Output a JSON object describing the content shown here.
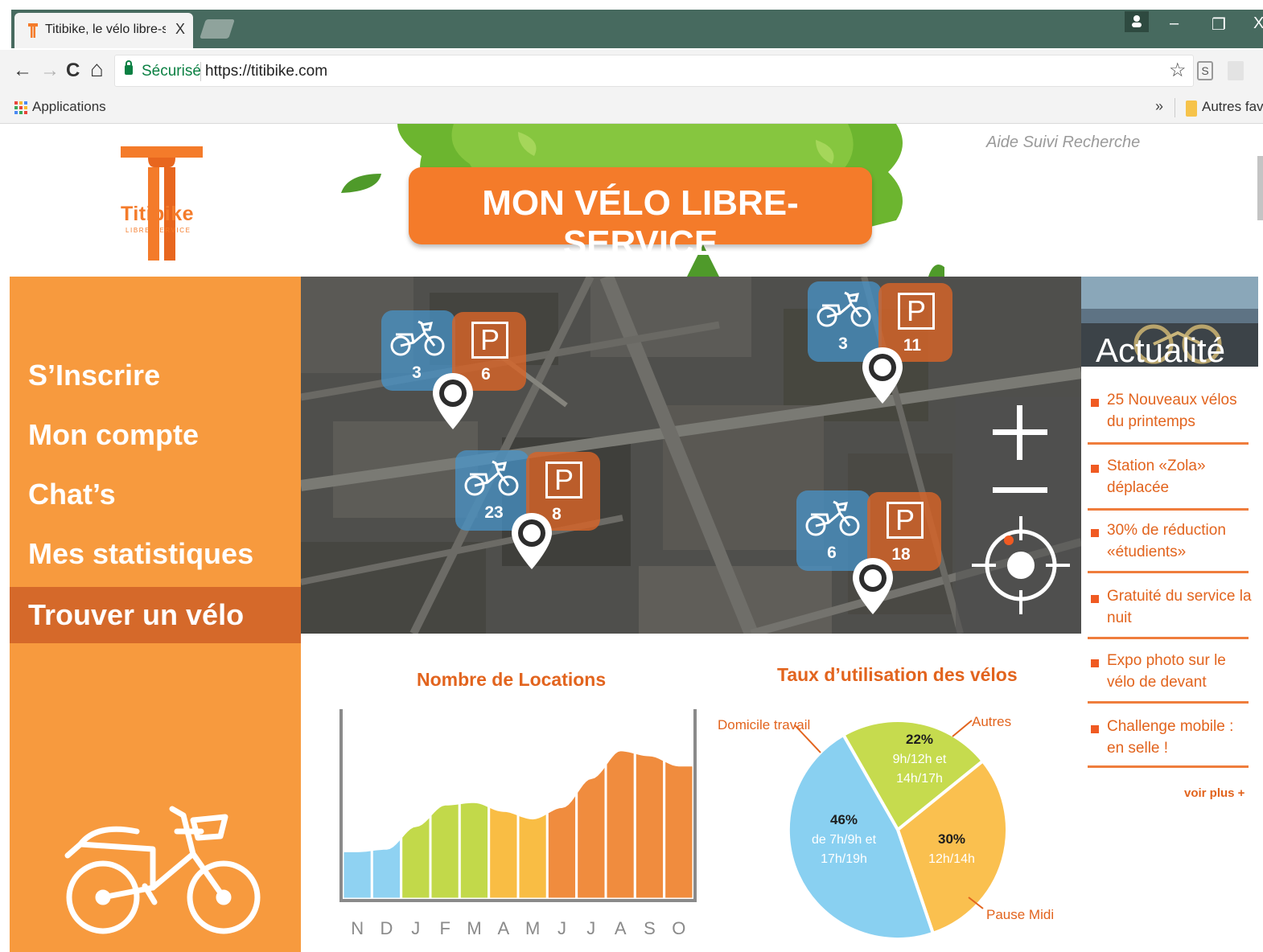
{
  "browser": {
    "tab_title": "Titibike, le vélo libre-serv",
    "tab_close": "X",
    "secure_label": "Sécurisé",
    "url": "https://titibike.com",
    "bookmark_apps": "Applications",
    "bookmark_more": "»",
    "bookmark_other": "Autres favor",
    "nav": {
      "back": "←",
      "forward": "→",
      "reload": "C",
      "home": "⌂",
      "star": "☆",
      "minimize": "–",
      "maximize": "❐",
      "close": "X"
    }
  },
  "header": {
    "logo_text": "Titibike",
    "logo_sub": "LIBRE-SERVICE",
    "banner": "MON VÉLO LIBRE-SERVICE",
    "top_links": "Aide Suivi Recherche"
  },
  "sidebar": {
    "items": [
      {
        "label": "S’Inscrire",
        "active": false
      },
      {
        "label": "Mon compte",
        "active": false
      },
      {
        "label": "Chat’s",
        "active": false
      },
      {
        "label": "Mes statistiques",
        "active": false
      },
      {
        "label": "Trouver un vélo",
        "active": true
      }
    ]
  },
  "map": {
    "stations": [
      {
        "bikes": "3",
        "parking": "6"
      },
      {
        "bikes": "3",
        "parking": "11"
      },
      {
        "bikes": "23",
        "parking": "8"
      },
      {
        "bikes": "6",
        "parking": "18"
      }
    ],
    "controls": {
      "zoom_in": "+",
      "zoom_out": "−"
    }
  },
  "news": {
    "title": "Actualité",
    "items": [
      "25 Nouveaux vélos du printemps",
      "Station «Zola» déplacée",
      "30% de réduction «étudients»",
      "Gratuité du service la nuit",
      "Expo photo sur le vélo de devant",
      "Challenge mobile : en selle !"
    ],
    "more": "voir plus +"
  },
  "chart_data": [
    {
      "type": "area",
      "title": "Nombre de Locations",
      "categories": [
        "N",
        "D",
        "J",
        "F",
        "M",
        "A",
        "M",
        "J",
        "J",
        "A",
        "S",
        "O"
      ],
      "values": [
        38,
        40,
        58,
        75,
        77,
        70,
        64,
        73,
        96,
        118,
        114,
        106
      ],
      "colors": [
        "#8fd2f2",
        "#8fd2f2",
        "#c2d94a",
        "#c2d94a",
        "#c2d94a",
        "#f9bd44",
        "#f9bd44",
        "#f08c3e",
        "#f08c3e",
        "#f08c3e",
        "#f08c3e",
        "#f08c3e"
      ],
      "ylim": [
        0,
        130
      ]
    },
    {
      "type": "pie",
      "title": "Taux d’utilisation des vélos",
      "slices": [
        {
          "name": "Autres",
          "value": 22,
          "pct": "22%",
          "detail": [
            "9h/12h et",
            "14h/17h"
          ],
          "color": "#c6db4e"
        },
        {
          "name": "Pause Midi",
          "value": 30,
          "pct": "30%",
          "detail": [
            "12h/14h"
          ],
          "color": "#fac04f"
        },
        {
          "name": "Domicile travail",
          "value": 46,
          "pct": "46%",
          "detail": [
            "de 7h/9h et",
            "17h/19h"
          ],
          "color": "#89d0f1"
        }
      ]
    }
  ]
}
